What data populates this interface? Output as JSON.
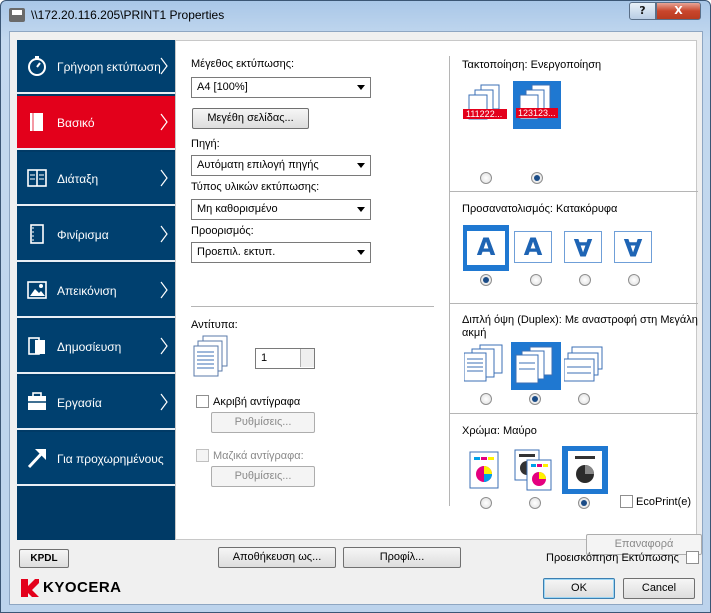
{
  "window": {
    "title": "\\\\172.20.116.205\\PRINT1 Properties",
    "help_label": "?",
    "close_label": "X"
  },
  "sidebar": {
    "items": [
      {
        "label": "Γρήγορη εκτύπωση",
        "icon": "stopwatch-icon"
      },
      {
        "label": "Βασικό",
        "icon": "page-icon",
        "active": true
      },
      {
        "label": "Διάταξη",
        "icon": "layout-icon"
      },
      {
        "label": "Φινίρισμα",
        "icon": "finishing-icon"
      },
      {
        "label": "Απεικόνιση",
        "icon": "image-icon"
      },
      {
        "label": "Δημοσίευση",
        "icon": "publishing-icon"
      },
      {
        "label": "Εργασία",
        "icon": "job-icon"
      },
      {
        "label": "Για προχωρημένους",
        "icon": "advanced-arrow-icon"
      }
    ]
  },
  "basic": {
    "print_size_label": "Μέγεθος εκτύπωσης:",
    "print_size_value": "A4  [100%]",
    "page_sizes_button": "Μεγέθη σελίδας...",
    "source_label": "Πηγή:",
    "source_value": "Αυτόματη επιλογή πηγής",
    "media_type_label": "Τύπος υλικών εκτύπωσης:",
    "media_type_value": "Μη καθορισμένο",
    "destination_label": "Προορισμός:",
    "destination_value": "Προεπιλ. εκτυπ.",
    "copies_label": "Αντίτυπα:",
    "copies_value": "1",
    "proof_copy_label": "Ακριβή αντίγραφα",
    "proof_settings_button": "Ρυθμίσεις...",
    "mass_copies_label": "Μαζικά αντίγραφα:",
    "mass_settings_button": "Ρυθμίσεις..."
  },
  "right": {
    "collate_label": "Τακτοποίηση:",
    "collate_value": "Ενεργοποίηση",
    "collate_off_caption": "111222...",
    "collate_on_caption": "123123...",
    "orientation_label": "Προσανατολισμός:",
    "orientation_value": "Κατακόρυφα",
    "orientation_glyph": "A",
    "duplex_label": "Διπλή όψη (Duplex):",
    "duplex_value": "Με αναστροφή στη Μεγάλη ακμή",
    "color_label": "Χρώμα:",
    "color_value": "Μαύρο",
    "ecoprint_label": "EcoPrint(e)",
    "reset_button": "Επαναφορά"
  },
  "footer": {
    "kpdl_button": "KPDL",
    "save_as_button": "Αποθήκευση ως...",
    "profile_button": "Προφίλ...",
    "preview_label": "Προεισκόπηση Εκτύπωσης",
    "ok_button": "OK",
    "cancel_button": "Cancel",
    "logo_text": "KYOCERA"
  },
  "colors": {
    "nav_bg": "#00406f",
    "nav_active": "#e3001b",
    "accent_blue": "#1f78d1",
    "logo_red": "#e3001b"
  }
}
